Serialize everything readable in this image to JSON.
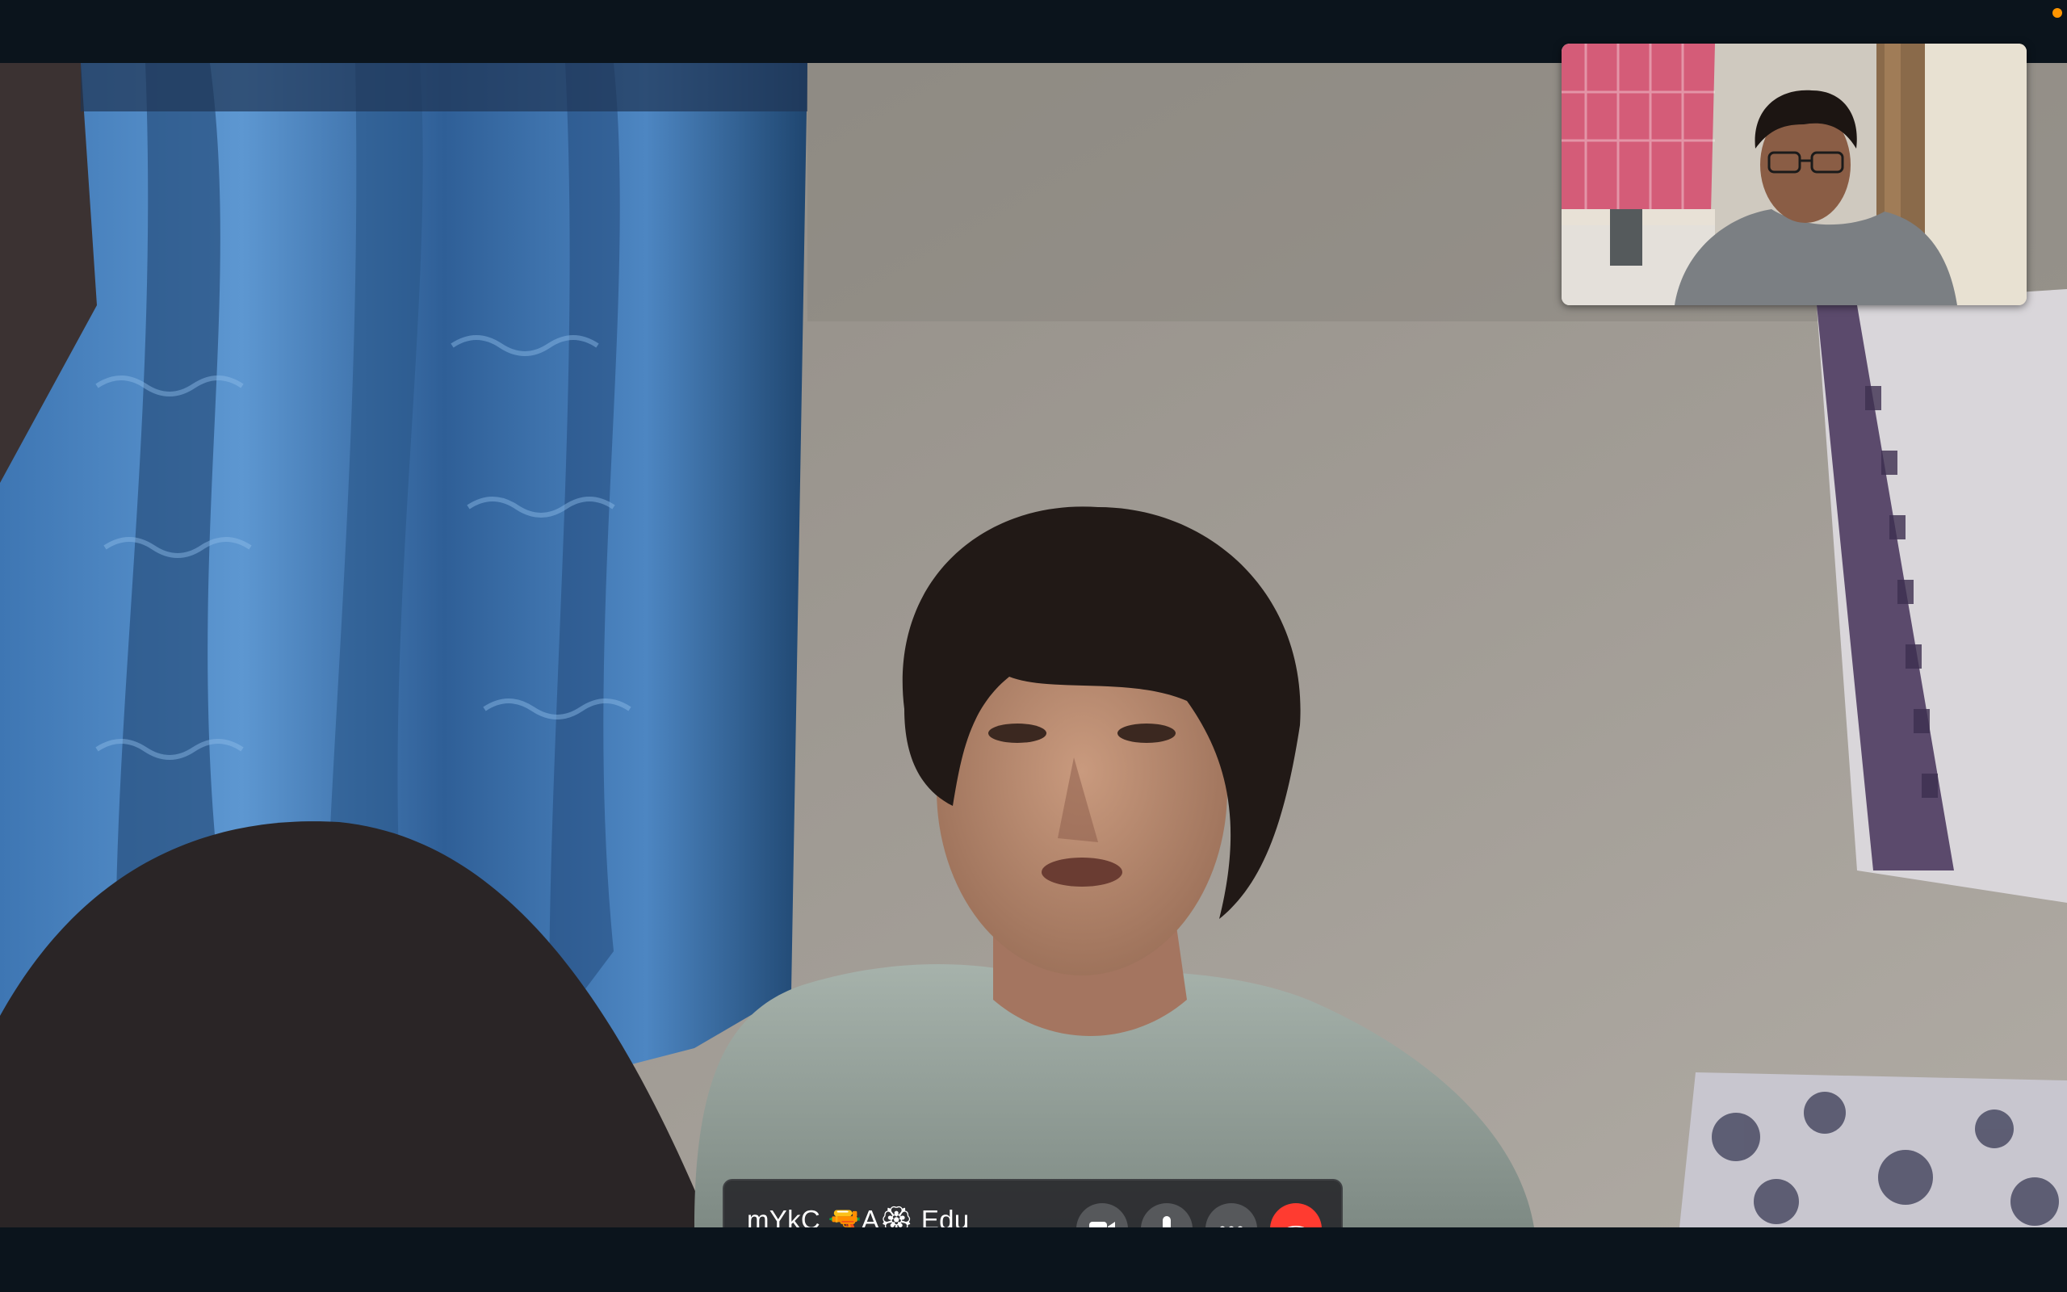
{
  "call": {
    "contact_name": "mYkC 🔫A🏵 Edu",
    "status": "connected"
  },
  "controls": {
    "camera_icon": "video-camera-icon",
    "mic_icon": "microphone-icon",
    "more_icon": "ellipsis-icon",
    "end_icon": "phone-hangup-icon"
  },
  "colors": {
    "background": "#0b141c",
    "control_bar": "#2a2c2f",
    "button": "#56585b",
    "end_call": "#ff3b30",
    "recording_indicator": "#ff9500"
  }
}
